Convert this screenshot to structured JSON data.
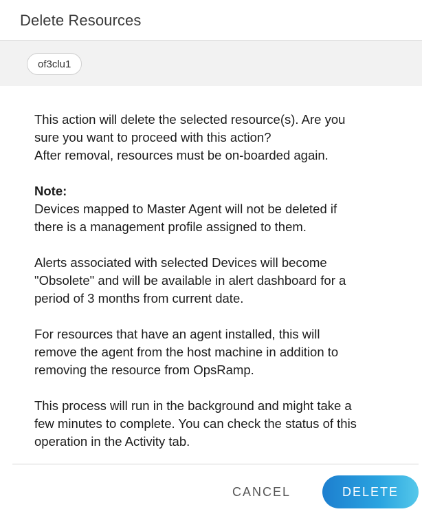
{
  "dialog": {
    "title": "Delete Resources"
  },
  "selected_resources": [
    "of3clu1"
  ],
  "body": {
    "intro_lines": [
      "This action will delete the selected resource(s). Are you",
      "sure you want to proceed with this action?",
      "After removal, resources must be on-boarded again."
    ],
    "note_heading": "Note:",
    "note_lines": [
      "Devices mapped to Master Agent will not be deleted if",
      "there is a management profile assigned to them."
    ],
    "alerts_lines": [
      "Alerts associated with selected Devices will become",
      "\"Obsolete\" and will be available in alert dashboard for a",
      "period of 3 months from current date."
    ],
    "agent_lines": [
      "For resources that have an agent installed, this will",
      "remove the agent from the host machine in addition to",
      "removing the resource from OpsRamp."
    ],
    "process_lines": [
      "This process will run in the background and might take a",
      "few minutes to complete. You can check the status of this",
      "operation in the Activity tab."
    ]
  },
  "footer": {
    "cancel_label": "CANCEL",
    "delete_label": "DELETE"
  }
}
